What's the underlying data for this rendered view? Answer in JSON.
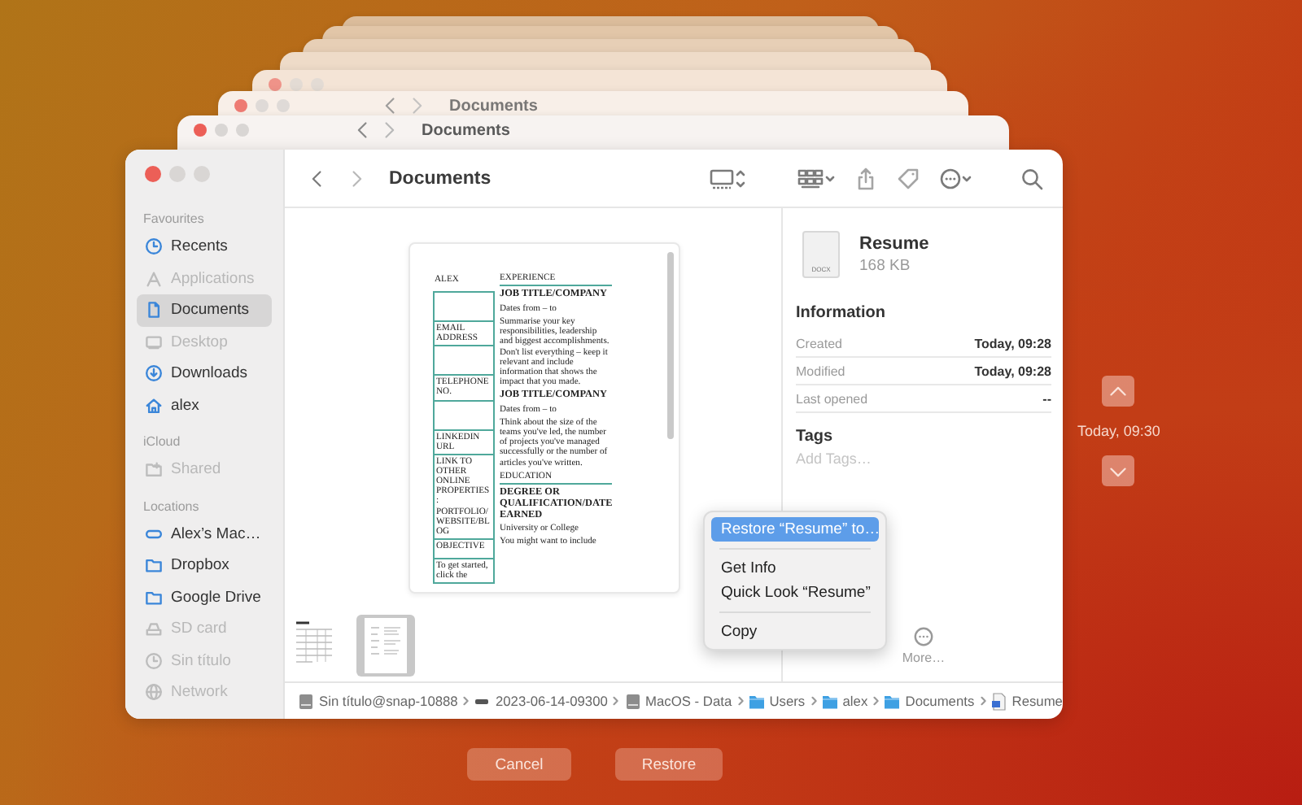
{
  "back_windows": [
    {
      "title": "Documents"
    },
    {
      "title": "Documents"
    }
  ],
  "window": {
    "title": "Documents"
  },
  "sidebar": {
    "sections": [
      {
        "heading": "Favourites",
        "items": [
          {
            "label": "Recents",
            "selected": false,
            "disabled": false
          },
          {
            "label": "Applications",
            "selected": false,
            "disabled": true
          },
          {
            "label": "Documents",
            "selected": true,
            "disabled": false
          },
          {
            "label": "Desktop",
            "selected": false,
            "disabled": true
          },
          {
            "label": "Downloads",
            "selected": false,
            "disabled": false
          },
          {
            "label": "alex",
            "selected": false,
            "disabled": false
          }
        ]
      },
      {
        "heading": "iCloud",
        "items": [
          {
            "label": "Shared",
            "selected": false,
            "disabled": true
          }
        ]
      },
      {
        "heading": "Locations",
        "items": [
          {
            "label": "Alex’s Mac…",
            "selected": false,
            "disabled": false
          },
          {
            "label": "Dropbox",
            "selected": false,
            "disabled": false
          },
          {
            "label": "Google Drive",
            "selected": false,
            "disabled": false
          },
          {
            "label": "SD card",
            "selected": false,
            "disabled": true
          },
          {
            "label": "Sin título",
            "selected": false,
            "disabled": true
          },
          {
            "label": "Network",
            "selected": false,
            "disabled": true
          }
        ]
      }
    ]
  },
  "preview": {
    "document": {
      "left_cells": [
        {
          "kind": "text",
          "text": "ALEX"
        },
        {
          "kind": "blank"
        },
        {
          "kind": "text",
          "text": "EMAIL ADDRESS"
        },
        {
          "kind": "blank"
        },
        {
          "kind": "text",
          "text": "TELEPHONE NO."
        },
        {
          "kind": "blank"
        },
        {
          "kind": "text",
          "text": "LINKEDIN URL"
        },
        {
          "kind": "text",
          "text": "LINK TO OTHER ONLINE PROPERTIES: PORTFOLIO/ WEBSITE/BLOG"
        },
        {
          "kind": "text",
          "text": "OBJECTIVE"
        },
        {
          "kind": "text",
          "text": "To get started, click the"
        }
      ],
      "right_blocks": [
        {
          "kind": "heading",
          "text": "EXPERIENCE"
        },
        {
          "kind": "entry",
          "title": "JOB TITLE/COMPANY",
          "lines": [
            "Dates from – to",
            "Summarise your key responsibilities, leadership and biggest accomplishments. Don't list everything – keep it relevant and include information that shows the impact that you made."
          ]
        },
        {
          "kind": "entry",
          "title": "JOB TITLE/COMPANY",
          "lines": [
            "Dates from – to",
            "Think about the size of the teams you've led, the number of projects you've managed successfully or the number of articles you've written."
          ]
        },
        {
          "kind": "heading",
          "text": "EDUCATION"
        },
        {
          "kind": "entry",
          "title": "DEGREE OR QUALIFICATION/DATE EARNED",
          "lines": [
            "University or College",
            "You might want to include"
          ]
        }
      ]
    },
    "thumbnails": [
      {
        "selected": false
      },
      {
        "selected": true
      }
    ]
  },
  "info": {
    "file_type": "DOCX",
    "name": "Resume",
    "size": "168 KB",
    "section_title": "Information",
    "rows": [
      {
        "label": "Created",
        "value": "Today, 09:28"
      },
      {
        "label": "Modified",
        "value": "Today, 09:28"
      },
      {
        "label": "Last opened",
        "value": "--"
      }
    ],
    "tags_title": "Tags",
    "tags_placeholder": "Add Tags…",
    "more": "More…"
  },
  "context_menu": [
    {
      "kind": "item",
      "label": "Restore “Resume” to…",
      "selected": true
    },
    {
      "kind": "separator"
    },
    {
      "kind": "item",
      "label": "Get Info",
      "selected": false
    },
    {
      "kind": "item",
      "label": "Quick Look “Resume”",
      "selected": false
    },
    {
      "kind": "separator"
    },
    {
      "kind": "item",
      "label": "Copy",
      "selected": false
    }
  ],
  "path_bar": [
    {
      "kind": "disk",
      "label": "Sin título@snap-10888"
    },
    {
      "kind": "snapshot",
      "label": "2023-06-14-09300"
    },
    {
      "kind": "disk",
      "label": "MacOS - Data"
    },
    {
      "kind": "folder",
      "label": "Users"
    },
    {
      "kind": "folder",
      "label": "alex"
    },
    {
      "kind": "folder",
      "label": "Documents"
    },
    {
      "kind": "file",
      "label": "Resume"
    }
  ],
  "timeline": {
    "time": "Today, 09:30"
  },
  "buttons": [
    {
      "label": "Cancel"
    },
    {
      "label": "Restore"
    }
  ]
}
